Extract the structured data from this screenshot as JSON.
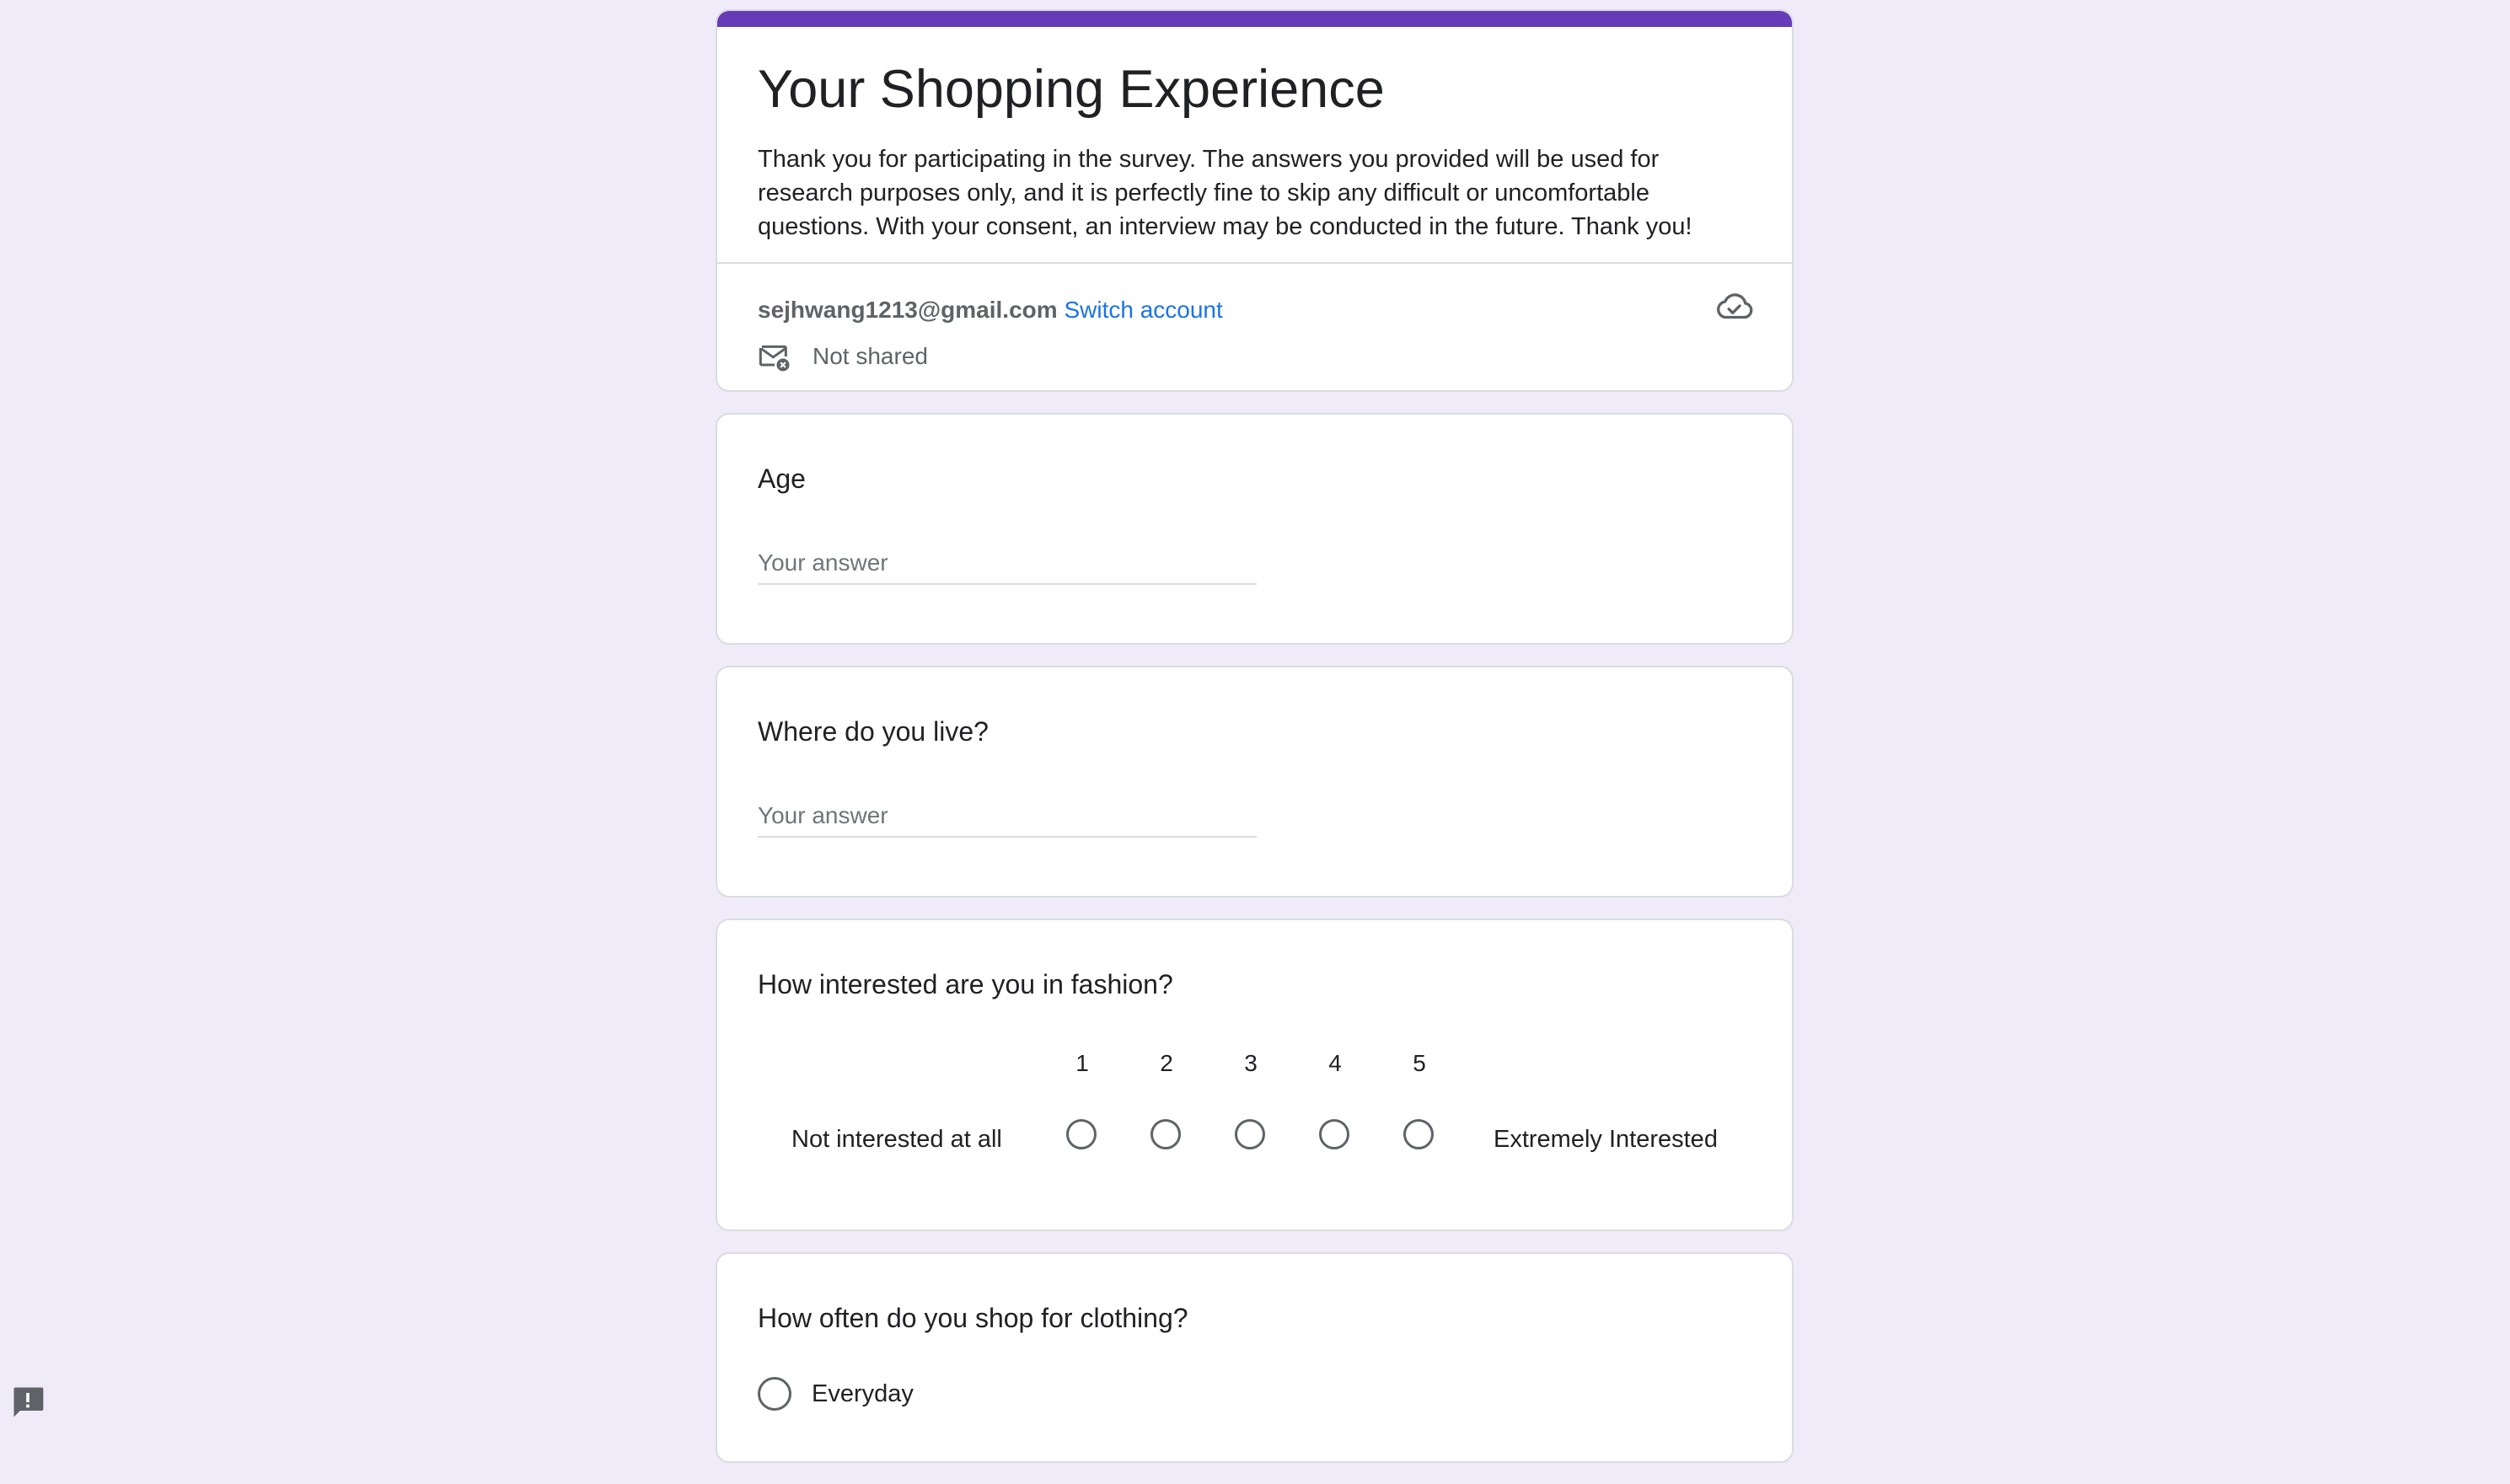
{
  "form": {
    "title": "Your Shopping Experience",
    "description": "Thank you for participating in the survey. The answers you provided will be used for research purposes only, and it is perfectly fine to skip any difficult or uncomfortable questions. With your consent, an interview may be conducted in the future. Thank you!",
    "accent_color": "#673ab7"
  },
  "account": {
    "email": "sejhwang1213@gmail.com",
    "switch_label": "Switch account",
    "not_shared_label": "Not shared",
    "status_icon": "cloud-check-icon",
    "mail_icon": "mail-not-shared-icon"
  },
  "questions": [
    {
      "title": "Age",
      "type": "short-answer",
      "placeholder": "Your answer"
    },
    {
      "title": "Where do you live?",
      "type": "short-answer",
      "placeholder": "Your answer"
    },
    {
      "title": "How interested are you in fashion?",
      "type": "linear-scale",
      "scale": [
        "1",
        "2",
        "3",
        "4",
        "5"
      ],
      "low_label": "Not interested at all",
      "high_label": "Extremely Interested"
    },
    {
      "title": "How often do you shop for clothing?",
      "type": "multiple-choice",
      "options": [
        "Everyday"
      ]
    }
  ],
  "report_icon": "report-feedback-icon"
}
